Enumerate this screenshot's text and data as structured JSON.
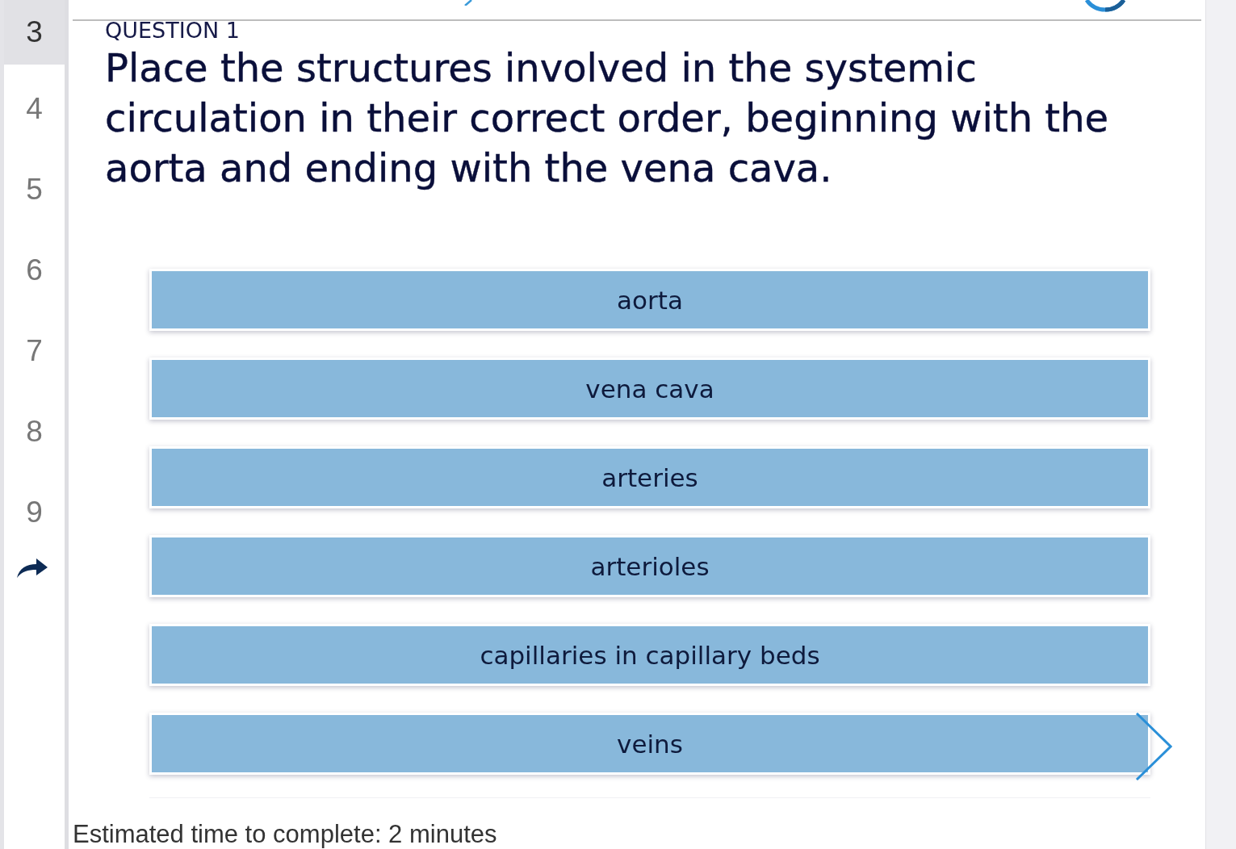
{
  "sidebar": {
    "items": [
      {
        "label": "3",
        "selected": true
      },
      {
        "label": "4",
        "selected": false
      },
      {
        "label": "5",
        "selected": false
      },
      {
        "label": "6",
        "selected": false
      },
      {
        "label": "7",
        "selected": false
      },
      {
        "label": "8",
        "selected": false
      },
      {
        "label": "9",
        "selected": false
      }
    ]
  },
  "question": {
    "label": "QUESTION 1",
    "prompt": "Place the structures involved in the systemic circulation in their correct order, beginning with the aorta and ending with the vena cava."
  },
  "answers": [
    {
      "label": "aorta"
    },
    {
      "label": "vena cava"
    },
    {
      "label": "arteries"
    },
    {
      "label": "arterioles"
    },
    {
      "label": "capillaries in capillary beds"
    },
    {
      "label": "veins"
    }
  ],
  "footer": {
    "estimate": "Estimated time to complete: 2 minutes"
  }
}
